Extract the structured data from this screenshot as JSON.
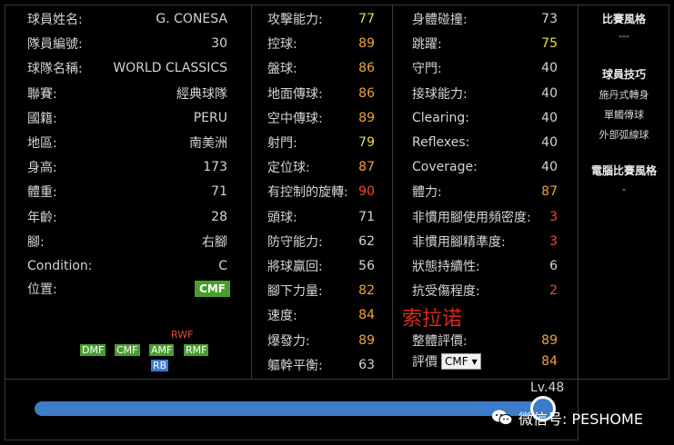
{
  "player_info": [
    {
      "label": "球員姓名:",
      "value": "G. CONESA"
    },
    {
      "label": "隊員編號:",
      "value": "30"
    },
    {
      "label": "球隊名稱:",
      "value": "WORLD CLASSICS"
    },
    {
      "label": "聯賽:",
      "value": "經典球隊"
    },
    {
      "label": "國籍:",
      "value": "PERU"
    },
    {
      "label": "地區:",
      "value": "南美洲"
    },
    {
      "label": "身高:",
      "value": "173"
    },
    {
      "label": "體重:",
      "value": "71"
    },
    {
      "label": "年齡:",
      "value": "28"
    },
    {
      "label": "腳:",
      "value": "右腳"
    },
    {
      "label": "Condition:",
      "value": "C"
    }
  ],
  "position": {
    "label": "位置:",
    "value": "CMF"
  },
  "position_map": {
    "top": "RWF",
    "row": [
      "DMF",
      "CMF",
      "AMF",
      "RMF"
    ],
    "bottom": "RB"
  },
  "stats_a": [
    {
      "label": "攻擊能力:",
      "value": "77",
      "color": "yellow"
    },
    {
      "label": "控球:",
      "value": "89",
      "color": "orange"
    },
    {
      "label": "盤球:",
      "value": "86",
      "color": "orange"
    },
    {
      "label": "地面傳球:",
      "value": "86",
      "color": "orange"
    },
    {
      "label": "空中傳球:",
      "value": "89",
      "color": "orange"
    },
    {
      "label": "射門:",
      "value": "79",
      "color": "yellow"
    },
    {
      "label": "定位球:",
      "value": "87",
      "color": "orange"
    },
    {
      "label": "有控制的旋轉:",
      "value": "90",
      "color": "red"
    },
    {
      "label": "頭球:",
      "value": "71",
      "color": "plain"
    },
    {
      "label": "防守能力:",
      "value": "62",
      "color": "plain"
    },
    {
      "label": "將球贏回:",
      "value": "56",
      "color": "plain"
    },
    {
      "label": "腳下力量:",
      "value": "82",
      "color": "orange"
    },
    {
      "label": "速度:",
      "value": "84",
      "color": "orange"
    },
    {
      "label": "爆發力:",
      "value": "89",
      "color": "orange"
    },
    {
      "label": "軀幹平衡:",
      "value": "63",
      "color": "plain"
    }
  ],
  "stats_b": [
    {
      "label": "身體碰撞:",
      "value": "73",
      "color": "plain"
    },
    {
      "label": "跳躍:",
      "value": "75",
      "color": "yellow"
    },
    {
      "label": "守門:",
      "value": "40",
      "color": "plain"
    },
    {
      "label": "接球能力:",
      "value": "40",
      "color": "plain"
    },
    {
      "label": "Clearing:",
      "value": "40",
      "color": "plain"
    },
    {
      "label": "Reflexes:",
      "value": "40",
      "color": "plain"
    },
    {
      "label": "Coverage:",
      "value": "40",
      "color": "plain"
    },
    {
      "label": "體力:",
      "value": "87",
      "color": "orange"
    },
    {
      "label": "非慣用腳使用頻密度:",
      "value": "3",
      "color": "red"
    },
    {
      "label": "非慣用腳精準度:",
      "value": "3",
      "color": "red"
    },
    {
      "label": "狀態持續性:",
      "value": "6",
      "color": "plain"
    },
    {
      "label": "抗受傷程度:",
      "value": "2",
      "color": "red"
    },
    {
      "label": "",
      "value": "",
      "color": "plain"
    },
    {
      "label": "整體評價:",
      "value": "89",
      "color": "orange"
    }
  ],
  "rating": {
    "label": "評價",
    "select_value": "CMF",
    "value": "84"
  },
  "watermark_text": "索拉诺",
  "sidebar": {
    "style_title": "比賽風格",
    "style_value": "---",
    "skills_title": "球員技巧",
    "skills": [
      "施丹式轉身",
      "單觸傳球",
      "外部弧線球"
    ],
    "ai_title": "電腦比賽風格",
    "ai_value": "-"
  },
  "level": {
    "label": "Lv.48",
    "progress": 0.98
  },
  "wechat": {
    "text": "微信号: PESHOME"
  },
  "colors": {
    "orange": "#f0a238",
    "yellow": "#f0dd3c",
    "red": "#f04d2a",
    "badge_green": "#4a9e2e",
    "badge_blue": "#3a7bd5",
    "bar_blue": "#3d7cc9"
  }
}
